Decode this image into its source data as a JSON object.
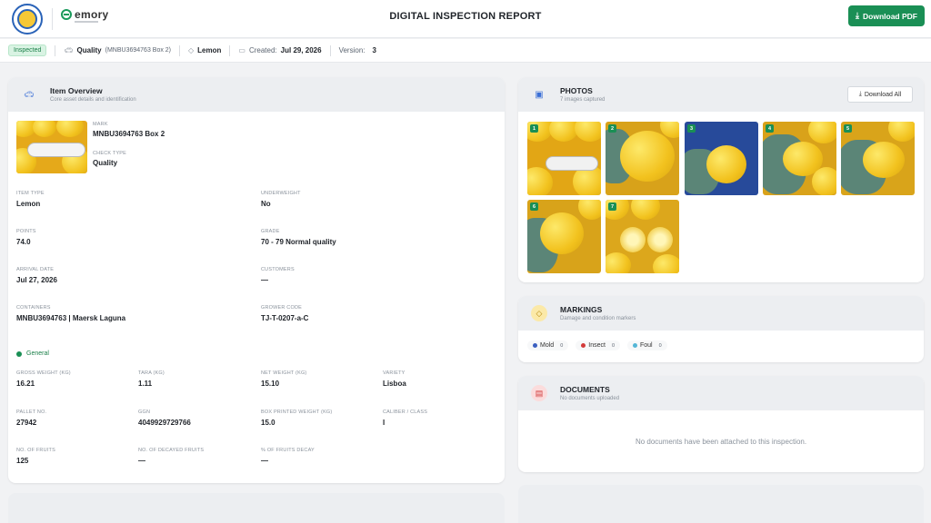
{
  "header": {
    "title": "DIGITAL INSPECTION REPORT",
    "brand": "emory",
    "download_pdf": "Download PDF"
  },
  "meta": {
    "status": "Inspected",
    "check_type": "Quality",
    "mark_ref": "(MNBU3694763 Box 2)",
    "item_type": "Lemon",
    "created_label": "Created:",
    "created_value": "Jul 29, 2026",
    "version_label": "Version:",
    "version_value": "3"
  },
  "overview": {
    "title": "Item Overview",
    "subtitle": "Core asset details and identification",
    "mark_label": "MARK",
    "mark_value": "MNBU3694763 Box 2",
    "check_label": "CHECK TYPE",
    "check_value": "Quality",
    "fields": [
      {
        "label": "ITEM TYPE",
        "value": "Lemon"
      },
      {
        "label": "UNDERWEIGHT",
        "value": "No"
      },
      {
        "label": "POINTS",
        "value": "74.0"
      },
      {
        "label": "GRADE",
        "value": "70 - 79 Normal quality"
      },
      {
        "label": "ARRIVAL DATE",
        "value": "Jul 27, 2026"
      },
      {
        "label": "CUSTOMERS",
        "value": "—"
      },
      {
        "label": "CONTAINERS",
        "value": "MNBU3694763 | Maersk Laguna"
      },
      {
        "label": "GROWER CODE",
        "value": "TJ-T-0207-a-C"
      }
    ],
    "general_label": "General",
    "general_fields": [
      {
        "label": "GROSS WEIGHT (KG)",
        "value": "16.21"
      },
      {
        "label": "TARA (KG)",
        "value": "1.11"
      },
      {
        "label": "NET WEIGHT (KG)",
        "value": "15.10"
      },
      {
        "label": "VARIETY",
        "value": "Lisboa"
      },
      {
        "label": "PALLET NO.",
        "value": "27942"
      },
      {
        "label": "GGN",
        "value": "4049929729766"
      },
      {
        "label": "BOX PRINTED WEIGHT (KG)",
        "value": "15.0"
      },
      {
        "label": "CALIBER / CLASS",
        "value": "I"
      },
      {
        "label": "NO. OF FRUITS",
        "value": "125"
      },
      {
        "label": "NO. OF DECAYED FRUITS",
        "value": "—"
      },
      {
        "label": "% OF FRUITS DECAY",
        "value": "—"
      }
    ]
  },
  "photos": {
    "title": "PHOTOS",
    "subtitle": "7 images captured",
    "download_all": "Download All",
    "numbers": [
      "1",
      "2",
      "3",
      "4",
      "5",
      "6",
      "7"
    ]
  },
  "markings": {
    "title": "MARKINGS",
    "subtitle": "Damage and condition markers",
    "items": [
      {
        "label": "Mold",
        "count": "0",
        "color": "#3b5fc0"
      },
      {
        "label": "Insect",
        "count": "0",
        "color": "#d23a3a"
      },
      {
        "label": "Foul",
        "count": "0",
        "color": "#54b6d6"
      }
    ]
  },
  "documents": {
    "title": "DOCUMENTS",
    "subtitle": "No documents uploaded",
    "empty": "No documents have been attached to this inspection."
  },
  "colors": {
    "accent_green": "#1a8f55"
  }
}
